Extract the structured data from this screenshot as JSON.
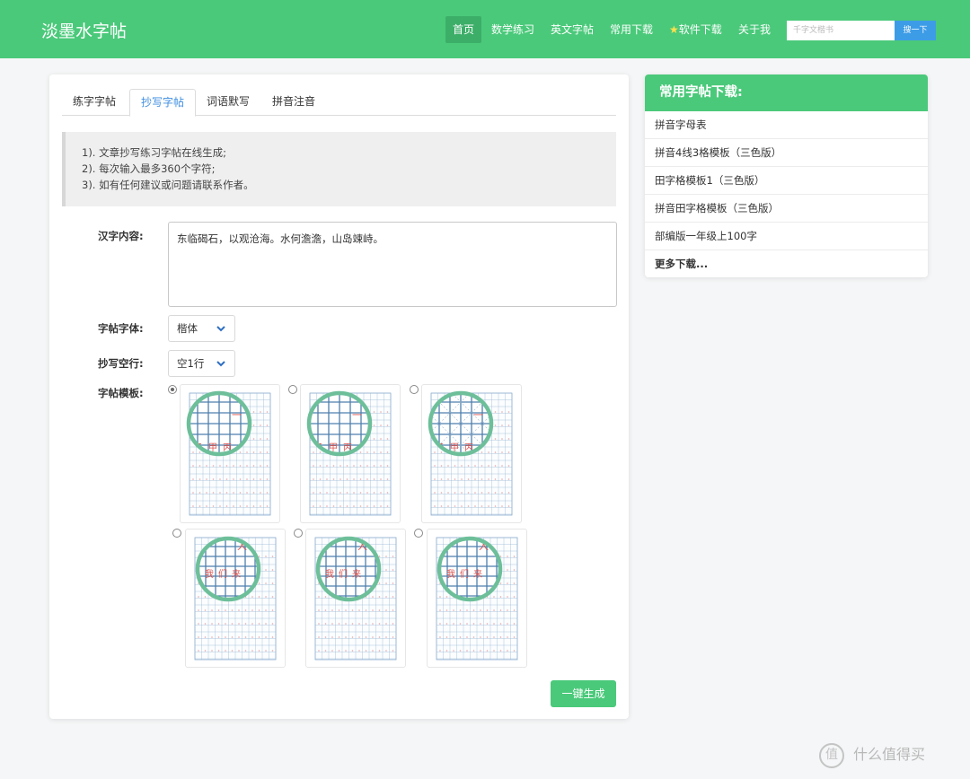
{
  "header": {
    "brand": "淡墨水字帖",
    "nav": [
      "首页",
      "数学练习",
      "英文字帖",
      "常用下载",
      "软件下载",
      "关于我"
    ],
    "search_placeholder": "千字文楷书",
    "search_button": "搜一下"
  },
  "tabs": [
    "练字字帖",
    "抄写字帖",
    "词语默写",
    "拼音注音"
  ],
  "active_tab": "抄写字帖",
  "notice": [
    "1). 文章抄写练习字帖在线生成;",
    "2). 每次输入最多360个字符;",
    "3). 如有任何建议或问题请联系作者。"
  ],
  "form": {
    "content_label": "汉字内容:",
    "content_value": "东临碣石，以观沧海。水何澹澹，山岛竦峙。",
    "font_label": "字帖字体:",
    "font_value": "楷体",
    "blank_label": "抄写空行:",
    "blank_value": "空1行",
    "template_label": "字帖模板:",
    "selected_template": 1,
    "generate_button": "一键生成"
  },
  "templates": {
    "top_row_chars": [
      "一",
      "乙",
      "甲",
      "丙"
    ],
    "bottom_row_chars": [
      "人",
      "我",
      "们",
      "来"
    ]
  },
  "sidebar": {
    "title": "常用字帖下载:",
    "items": [
      "拼音字母表",
      "拼音4线3格模板（三色版）",
      "田字格模板1（三色版）",
      "拼音田字格模板（三色版）",
      "部编版一年级上100字",
      "更多下载..."
    ]
  },
  "watermark": {
    "logo": "值",
    "text": "什么值得买"
  },
  "colors": {
    "brand_green": "#4ac97a",
    "search_blue": "#3d9ce6",
    "tab_blue": "#3d8ee0",
    "grid_blue": "#8fb0cf",
    "char_red": "#d9534f",
    "zoom_ring": "#6dbf9a"
  }
}
